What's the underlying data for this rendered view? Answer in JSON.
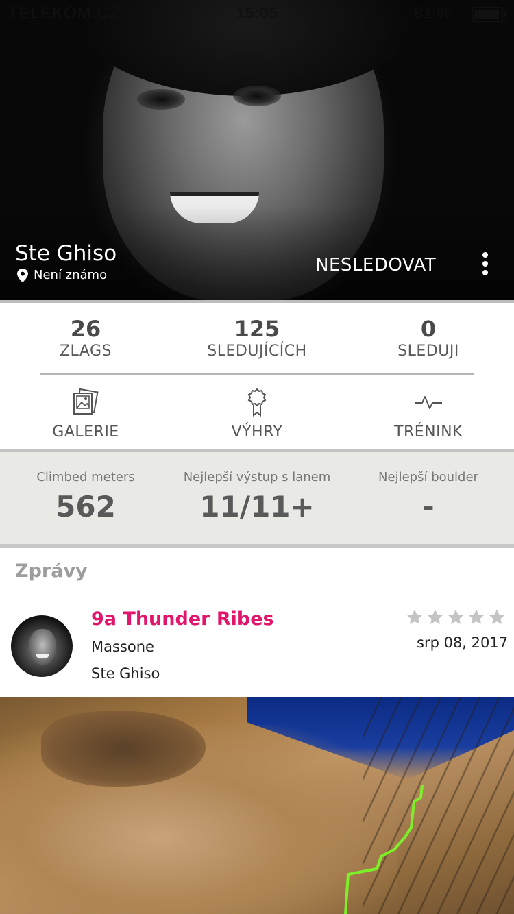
{
  "status_bar": {
    "carrier": "TELEKOM.CZ",
    "time": "15:05",
    "battery": "81 %"
  },
  "profile": {
    "name": "Ste Ghiso",
    "location": "Není známo",
    "follow_button": "NESLEDOVAT"
  },
  "stats": [
    {
      "value": "26",
      "label": "ZLAGS"
    },
    {
      "value": "125",
      "label": "SLEDUJÍCÍCH"
    },
    {
      "value": "0",
      "label": "SLEDUJI"
    }
  ],
  "nav": [
    {
      "label": "GALERIE",
      "icon": "gallery-icon"
    },
    {
      "label": "VÝHRY",
      "icon": "award-icon"
    },
    {
      "label": "TRÉNINK",
      "icon": "activity-icon"
    }
  ],
  "metrics": [
    {
      "label": "Climbed meters",
      "value": "562"
    },
    {
      "label": "Nejlepší výstup s lanem",
      "value": "11/11+"
    },
    {
      "label": "Nejlepší boulder",
      "value": "-"
    }
  ],
  "news": {
    "title": "Zprávy",
    "items": [
      {
        "route": "9a Thunder Ribes",
        "crag": "Massone",
        "user": "Ste Ghiso",
        "date": "srp 08, 2017",
        "rating": 0,
        "max_rating": 5
      }
    ]
  },
  "colors": {
    "accent": "#e0156b",
    "route_line": "#7ef02a",
    "metrics_bg": "#e9e9e6"
  }
}
